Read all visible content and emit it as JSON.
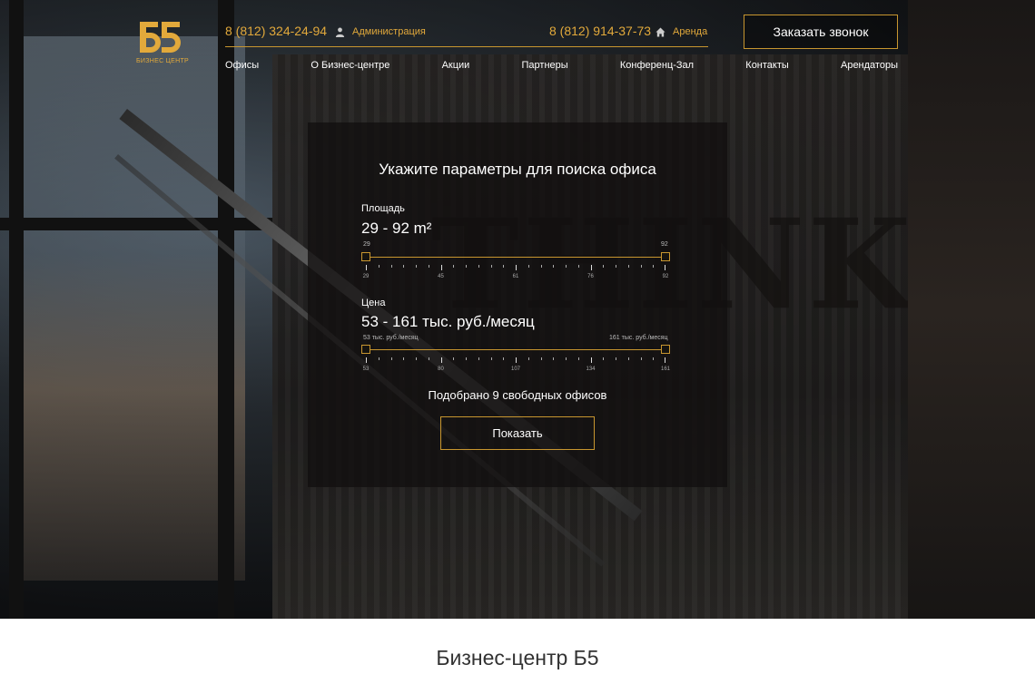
{
  "brand": {
    "logo_text": "БИЗНЕС ЦЕНТР",
    "accent_color": "#e2a93b",
    "icon": "b5-logo"
  },
  "header": {
    "phone_1": "8 (812) 324-24-94",
    "link_1": {
      "label": "Администрация",
      "icon": "person-icon"
    },
    "phone_2": "8 (812) 914-37-73",
    "link_2": {
      "label": "Аренда",
      "icon": "home-icon"
    },
    "call_button": "Заказать звонок"
  },
  "nav": [
    "Офисы",
    "О Бизнес-центре",
    "Акции",
    "Партнеры",
    "Конференц-Зал",
    "Контакты",
    "Арендаторы"
  ],
  "search": {
    "title": "Укажите параметры для поиска офиса",
    "area": {
      "label": "Площадь",
      "value_text": "29 - 92 m²",
      "min": 29,
      "max": 92,
      "low": 29,
      "high": 92,
      "low_label": "29",
      "high_label": "92",
      "tick_labels": [
        "29",
        "45",
        "61",
        "76",
        "92"
      ]
    },
    "price": {
      "label": "Цена",
      "value_text": "53 - 161 тыс. руб./месяц",
      "min": 53,
      "max": 161,
      "low": 53,
      "high": 161,
      "low_label": "53 тыс. руб./месяц",
      "high_label": "161 тыс. руб./месяц",
      "tick_labels": [
        "53",
        "80",
        "107",
        "134",
        "161"
      ]
    },
    "result_text": "Подобрано 9 свободных офисов",
    "show_button": "Показать"
  },
  "background_text": "THINK!",
  "section_title": "Бизнес-центр Б5"
}
